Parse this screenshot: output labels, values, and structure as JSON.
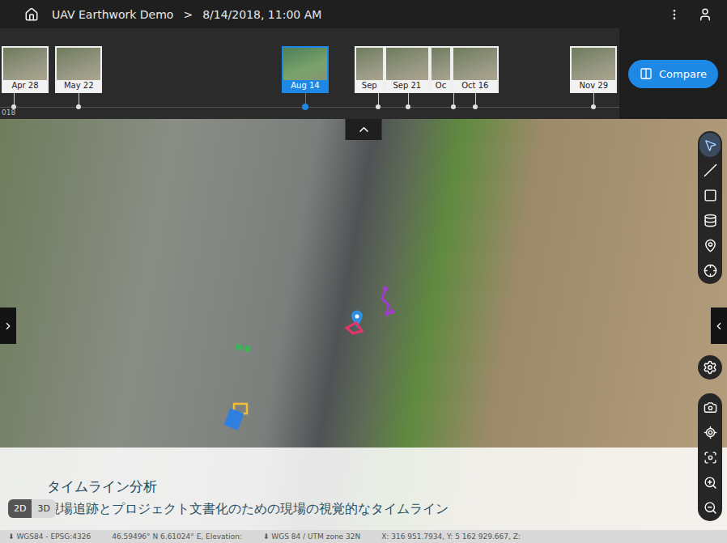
{
  "top_bar": {
    "project": "UAV Earthwork Demo",
    "separator": ">",
    "datetime": "8/14/2018, 11:00 AM"
  },
  "timeline": {
    "year": "018",
    "captures": [
      {
        "label": "Apr 28",
        "day": 118,
        "selected": false
      },
      {
        "label": "May 22",
        "day": 142,
        "selected": false
      },
      {
        "label": "Aug 14",
        "day": 226,
        "selected": true
      },
      {
        "label": "Sep",
        "day": 253,
        "selected": false
      },
      {
        "label": "Sep 21",
        "day": 264,
        "selected": false
      },
      {
        "label": "Oc",
        "day": 281,
        "selected": false
      },
      {
        "label": "Oct 16",
        "day": 289,
        "selected": false
      },
      {
        "label": "Nov 29",
        "day": 333,
        "selected": false
      }
    ]
  },
  "compare_button": {
    "label": "Compare"
  },
  "tools": [
    {
      "selected": true
    },
    {
      "selected": false
    },
    {
      "selected": false
    },
    {
      "selected": false
    },
    {
      "selected": false
    },
    {
      "selected": false
    }
  ],
  "annotations": [
    {
      "kind": "pin",
      "color": "#2f8fe0"
    },
    {
      "kind": "polygon",
      "color": "#e8336b"
    },
    {
      "kind": "polyline",
      "color": "#a03cd0"
    },
    {
      "kind": "outline",
      "color": "#f2c02e"
    },
    {
      "kind": "box",
      "color": "#2f7fe0"
    },
    {
      "kind": "dots",
      "color": "#3cb45a"
    }
  ],
  "view_modes": [
    {
      "label": "2D",
      "selected": true
    },
    {
      "label": "3D",
      "selected": false
    }
  ],
  "caption": {
    "title": "タイムライン分析",
    "subtitle": "現場追跡とプロジェクト文書化のための現場の視覚的なタイムライン"
  },
  "status_bar": [
    "⬇ WGS84 - EPSG:4326",
    "46.59496° N 6.61024° E, Elevation:",
    "⬇ WGS 84 / UTM zone 32N",
    "X: 316 951.7934, Y: 5 162 929.667, Z:"
  ]
}
